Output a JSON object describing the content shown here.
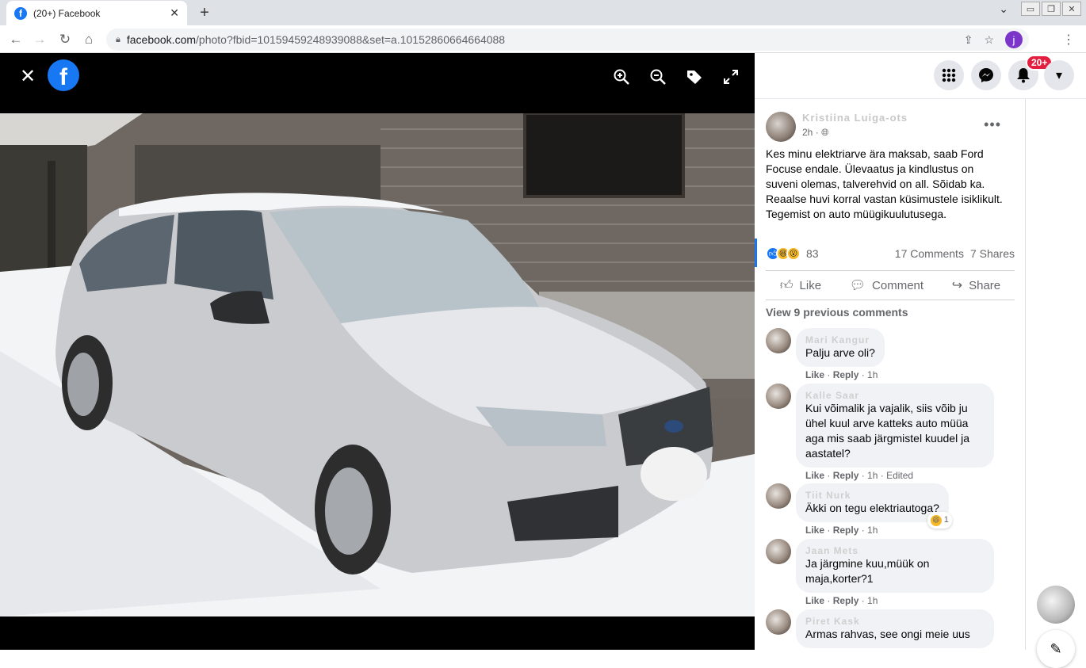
{
  "browser": {
    "tab_title": "(20+) Facebook",
    "tab_favicon": "f",
    "tab_close": "✕",
    "new_tab": "+",
    "url_host": "facebook.com",
    "url_path": "/photo?fbid=10159459248939088&set=a.10152860664664088",
    "profile_initial": "j"
  },
  "viewer": {
    "close_icon": "✕",
    "logo_letter": "f",
    "tools": [
      "zoom-in-icon",
      "zoom-out-icon",
      "tag-icon",
      "fullscreen-icon"
    ]
  },
  "topnav": {
    "notification_badge": "20+"
  },
  "post": {
    "author": "Kristiina Luiga-ots",
    "time": "2h",
    "privacy_icon": "globe-icon",
    "text_lines": [
      "Kes minu elektriarve ära maksab, saab Ford Focuse endale. Ülevaatus ja kindlustus on suveni olemas, talverehvid on all. Sõidab ka.",
      "Reaalse huvi korral vastan küsimustele isiklikult. Tegemist on auto müügikuulutusega."
    ],
    "reaction_count": "83",
    "comments_count": "17 Comments",
    "shares_count": "7 Shares",
    "actions": {
      "like": "Like",
      "comment": "Comment",
      "share": "Share"
    },
    "view_previous": "View 9 previous comments"
  },
  "comments": [
    {
      "name": "Mari Kangur",
      "text": "Palju arve oli?",
      "like": "Like",
      "reply": "Reply",
      "time": "1h",
      "edited": ""
    },
    {
      "name": "Kalle Saar",
      "text": "Kui võimalik ja vajalik, siis võib ju ühel kuul arve katteks auto müüa aga mis saab järgmistel kuudel ja aastatel?",
      "like": "Like",
      "reply": "Reply",
      "time": "1h",
      "edited": "Edited"
    },
    {
      "name": "Tiit Nurk",
      "text": "Äkki on tegu elektriautoga?",
      "like": "Like",
      "reply": "Reply",
      "time": "1h",
      "edited": "",
      "reaction": "1"
    },
    {
      "name": "Jaan Mets",
      "text": "Ja järgmine kuu,müük on maja,korter?1",
      "like": "Like",
      "reply": "Reply",
      "time": "1h",
      "edited": ""
    },
    {
      "name": "Piret Kask",
      "text": "Armas rahvas, see ongi meie uus",
      "like": "",
      "reply": "",
      "time": "",
      "edited": ""
    }
  ]
}
